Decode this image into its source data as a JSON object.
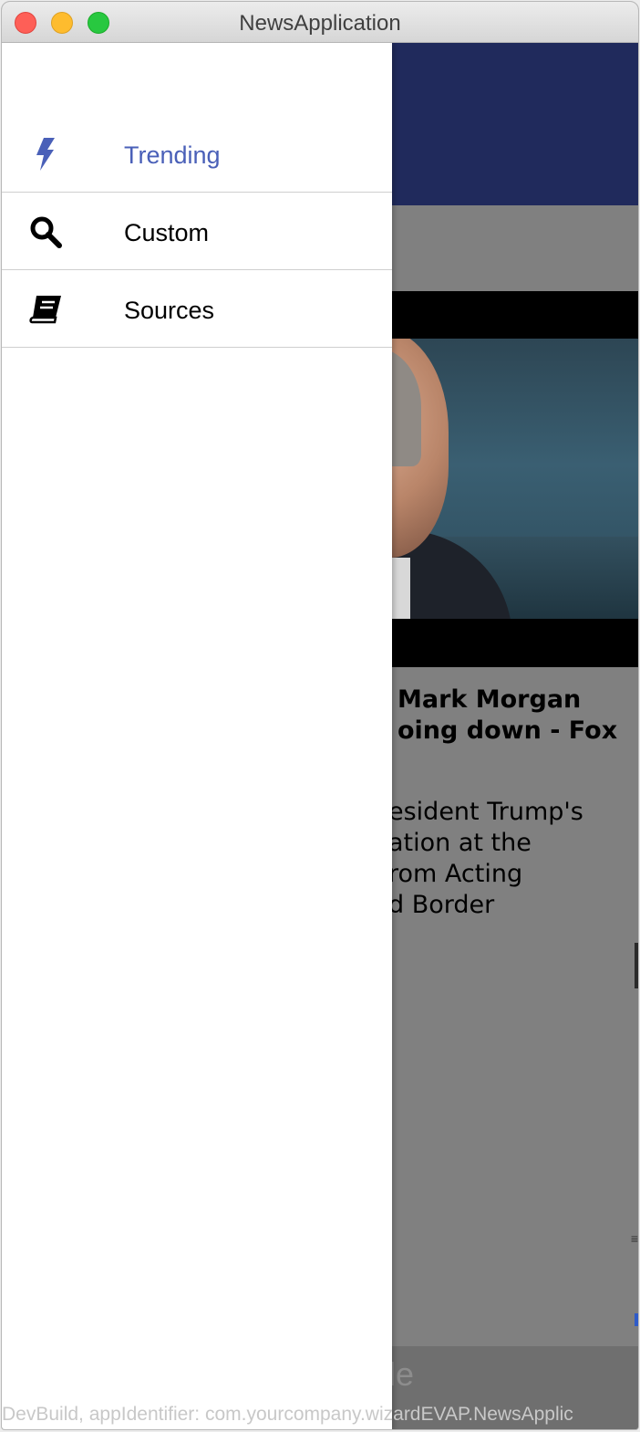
{
  "window": {
    "title": "NewsApplication"
  },
  "drawer": {
    "items": [
      {
        "label": "Trending",
        "icon": "lightning-bolt-icon",
        "active": true
      },
      {
        "label": "Custom",
        "icon": "search-icon",
        "active": false
      },
      {
        "label": "Sources",
        "icon": "book-icon",
        "active": false
      }
    ]
  },
  "article": {
    "headline_visible": "Mark Morgan\noing down - Fox",
    "description_visible": "esident Trump's\nation at the\nrom Acting\nd Border"
  },
  "bottom_bar": {
    "text_visible": "le"
  },
  "watermark": {
    "text": "DevBuild, appIdentifier: com.yourcompany.wizardEVAP.NewsApplic"
  },
  "colors": {
    "app_bar": "#202a5c",
    "active_item": "#4a60b8",
    "scrim": "#808080"
  }
}
